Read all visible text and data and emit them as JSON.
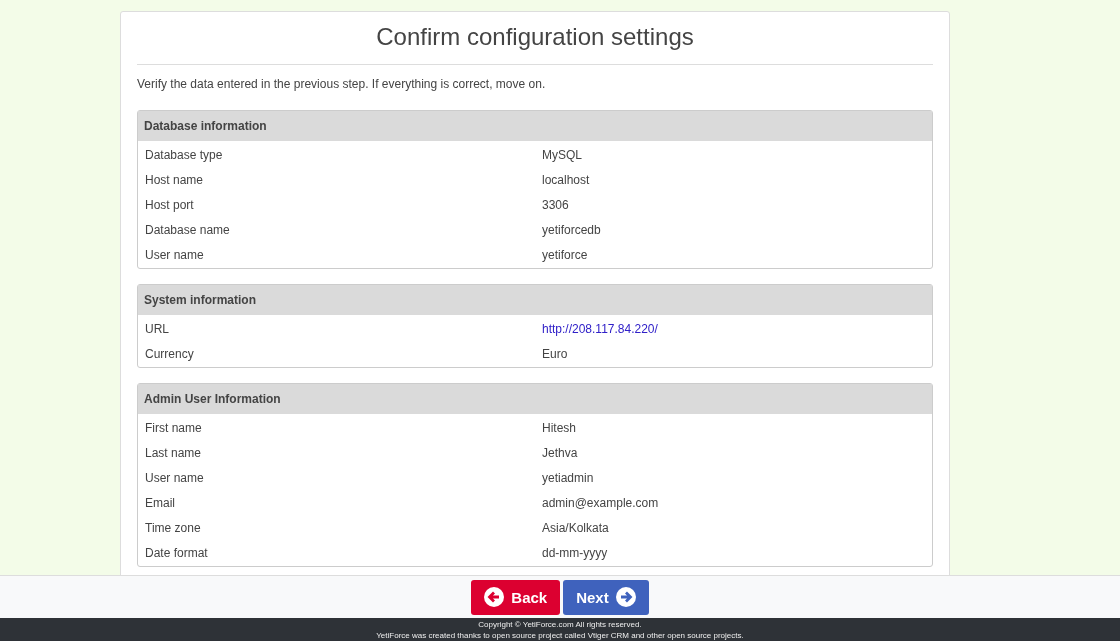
{
  "title": "Confirm configuration settings",
  "intro": "Verify the data entered in the previous step. If everything is correct, move on.",
  "sections": [
    {
      "heading": "Database information",
      "rows": [
        {
          "label": "Database type",
          "value": "MySQL",
          "kind": "text"
        },
        {
          "label": "Host name",
          "value": "localhost",
          "kind": "text"
        },
        {
          "label": "Host port",
          "value": "3306",
          "kind": "text"
        },
        {
          "label": "Database name",
          "value": "yetiforcedb",
          "kind": "text"
        },
        {
          "label": "User name",
          "value": "yetiforce",
          "kind": "text"
        }
      ]
    },
    {
      "heading": "System information",
      "rows": [
        {
          "label": "URL",
          "value": "http://208.117.84.220/",
          "kind": "link"
        },
        {
          "label": "Currency",
          "value": "Euro",
          "kind": "text"
        }
      ]
    },
    {
      "heading": "Admin User Information",
      "rows": [
        {
          "label": "First name",
          "value": "Hitesh",
          "kind": "text"
        },
        {
          "label": "Last name",
          "value": "Jethva",
          "kind": "text"
        },
        {
          "label": "User name",
          "value": "yetiadmin",
          "kind": "text"
        },
        {
          "label": "Email",
          "value": "admin@example.com",
          "kind": "text"
        },
        {
          "label": "Time zone",
          "value": "Asia/Kolkata",
          "kind": "text"
        },
        {
          "label": "Date format",
          "value": "dd-mm-yyyy",
          "kind": "text"
        }
      ]
    }
  ],
  "buttons": [
    {
      "label": "Back",
      "kind": "back"
    },
    {
      "label": "Next",
      "kind": "next"
    }
  ],
  "footer": [
    "Copyright © YetiForce.com All rights reserved.",
    "YetiForce was created thanks to open source project called Vtiger CRM and other open source projects."
  ]
}
